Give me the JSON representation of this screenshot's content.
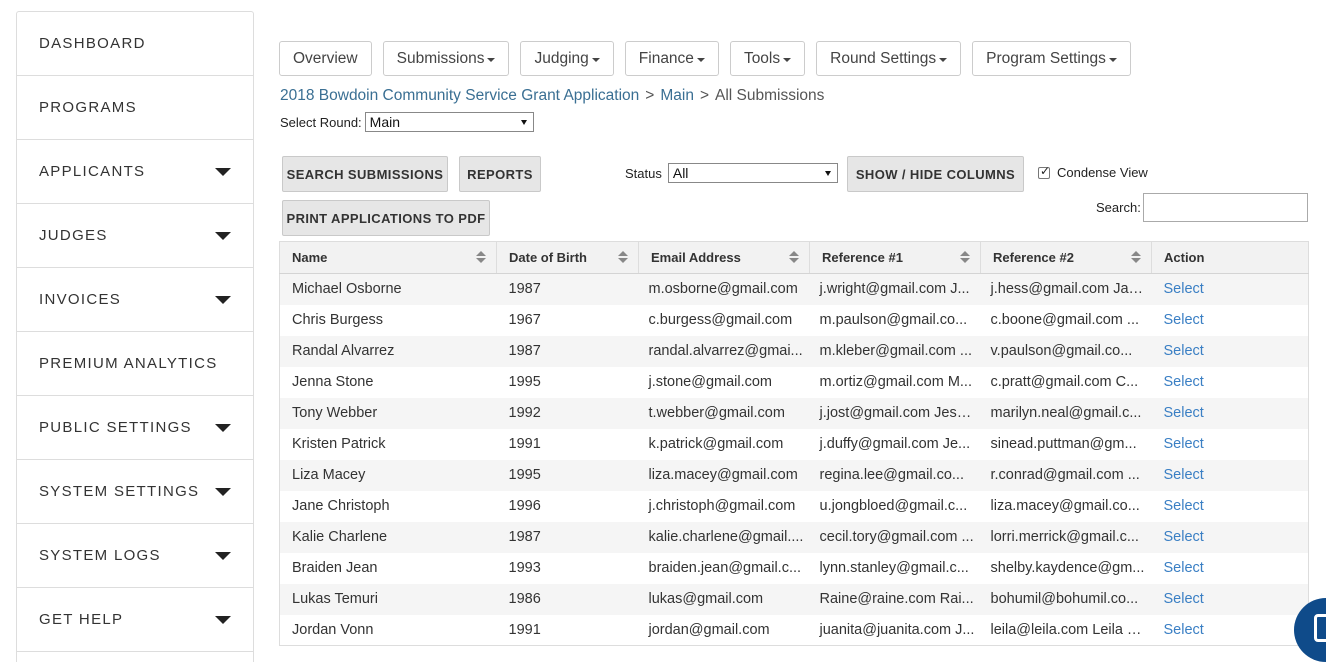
{
  "sidebar": {
    "items": [
      {
        "label": "DASHBOARD",
        "caret": false
      },
      {
        "label": "PROGRAMS",
        "caret": false
      },
      {
        "label": "APPLICANTS",
        "caret": true
      },
      {
        "label": "JUDGES",
        "caret": true
      },
      {
        "label": "INVOICES",
        "caret": true
      },
      {
        "label": "PREMIUM ANALYTICS",
        "caret": false
      },
      {
        "label": "PUBLIC SETTINGS",
        "caret": true
      },
      {
        "label": "SYSTEM SETTINGS",
        "caret": true
      },
      {
        "label": "SYSTEM LOGS",
        "caret": true
      },
      {
        "label": "GET HELP",
        "caret": true
      }
    ]
  },
  "topnav": {
    "items": [
      {
        "label": "Overview",
        "dropdown": false
      },
      {
        "label": "Submissions",
        "dropdown": true
      },
      {
        "label": "Judging",
        "dropdown": true
      },
      {
        "label": "Finance",
        "dropdown": true
      },
      {
        "label": "Tools",
        "dropdown": true
      },
      {
        "label": "Round Settings",
        "dropdown": true
      },
      {
        "label": "Program Settings",
        "dropdown": true
      }
    ]
  },
  "breadcrumb": {
    "program": "2018 Bowdoin Community Service Grant Application",
    "sep": ">",
    "round": "Main",
    "current": "All Submissions"
  },
  "round_select": {
    "label": "Select Round:",
    "value": "Main"
  },
  "buttons": {
    "search_submissions": "SEARCH SUBMISSIONS",
    "reports": "REPORTS",
    "print_pdf": "PRINT APPLICATIONS TO PDF",
    "show_hide_columns": "SHOW / HIDE COLUMNS"
  },
  "status_filter": {
    "label": "Status",
    "value": "All"
  },
  "condense_view": {
    "label": "Condense View",
    "checked": true
  },
  "search": {
    "label": "Search:",
    "value": ""
  },
  "table": {
    "columns": [
      "Name",
      "Date of Birth",
      "Email Address",
      "Reference #1",
      "Reference #2",
      "Action"
    ],
    "rows": [
      [
        "Michael Osborne",
        "1987",
        "m.osborne@gmail.com",
        "j.wright@gmail.com J...",
        "j.hess@gmail.com Jay...",
        "Select"
      ],
      [
        "Chris Burgess",
        "1967",
        "c.burgess@gmail.com",
        "m.paulson@gmail.co...",
        "c.boone@gmail.com ...",
        "Select"
      ],
      [
        "Randal Alvarrez",
        "1987",
        "randal.alvarrez@gmai...",
        "m.kleber@gmail.com ...",
        "v.paulson@gmail.co...",
        "Select"
      ],
      [
        "Jenna Stone",
        "1995",
        "j.stone@gmail.com",
        "m.ortiz@gmail.com M...",
        "c.pratt@gmail.com C...",
        "Select"
      ],
      [
        "Tony Webber",
        "1992",
        "t.webber@gmail.com",
        "j.jost@gmail.com Jess...",
        "marilyn.neal@gmail.c...",
        "Select"
      ],
      [
        "Kristen Patrick",
        "1991",
        "k.patrick@gmail.com",
        "j.duffy@gmail.com Je...",
        "sinead.puttman@gm...",
        "Select"
      ],
      [
        "Liza Macey",
        "1995",
        "liza.macey@gmail.com",
        "regina.lee@gmail.co...",
        "r.conrad@gmail.com ...",
        "Select"
      ],
      [
        "Jane Christoph",
        "1996",
        "j.christoph@gmail.com",
        "u.jongbloed@gmail.c...",
        "liza.macey@gmail.co...",
        "Select"
      ],
      [
        "Kalie Charlene",
        "1987",
        "kalie.charlene@gmail....",
        "cecil.tory@gmail.com ...",
        "lorri.merrick@gmail.c...",
        "Select"
      ],
      [
        "Braiden Jean",
        "1993",
        "braiden.jean@gmail.c...",
        "lynn.stanley@gmail.c...",
        "shelby.kaydence@gm...",
        "Select"
      ],
      [
        "Lukas Temuri",
        "1986",
        "lukas@gmail.com",
        "Raine@raine.com Rai...",
        "bohumil@bohumil.co...",
        "Select"
      ],
      [
        "Jordan Vonn",
        "1991",
        "jordan@gmail.com",
        "juanita@juanita.com J...",
        "leila@leila.com Leila J...",
        "Select"
      ]
    ]
  },
  "colors": {
    "link": "#3a7fc4",
    "breadcrumb_link": "#3a6f93",
    "chat": "#0f4b8a"
  }
}
